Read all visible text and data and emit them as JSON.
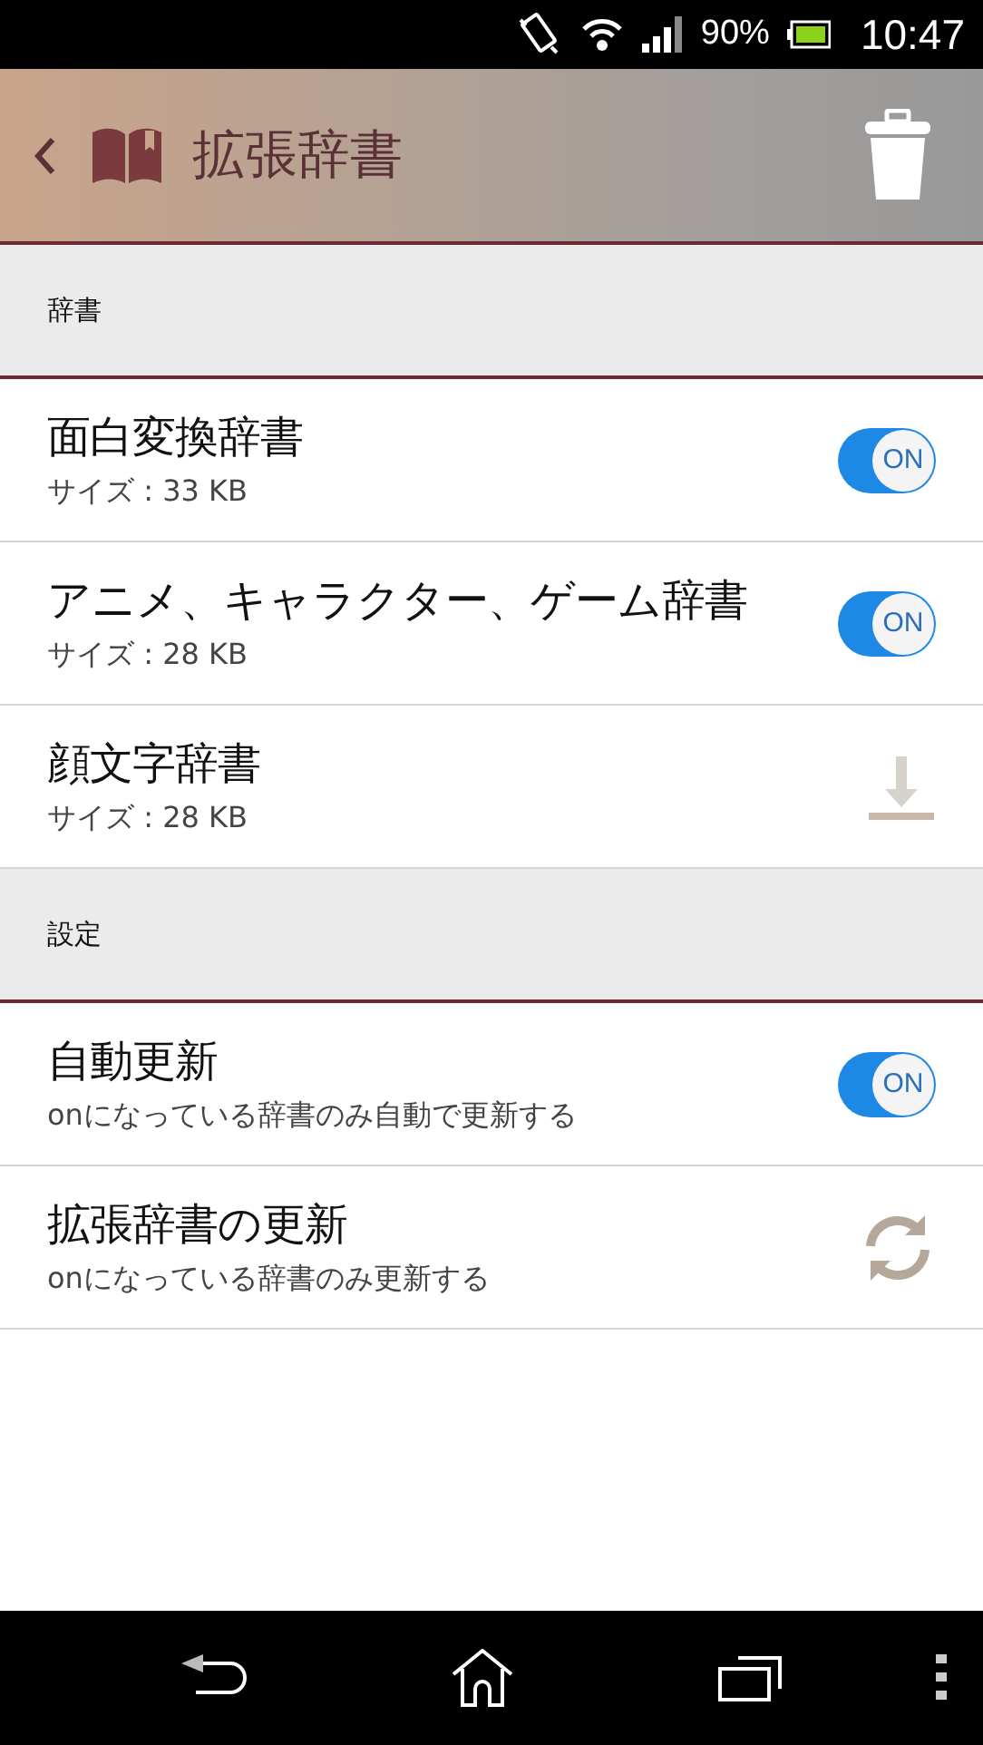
{
  "status_bar": {
    "battery": "90%",
    "time": "10:47"
  },
  "app_bar": {
    "title": "拡張辞書"
  },
  "sections": [
    {
      "header": "辞書",
      "items": [
        {
          "kind": "toggle",
          "title": "面白変換辞書",
          "subtitle": "サイズ : 33 KB",
          "on": true,
          "toggle_label": "ON"
        },
        {
          "kind": "toggle",
          "title": "アニメ、キャラクター、ゲーム辞書",
          "subtitle": "サイズ : 28 KB",
          "on": true,
          "toggle_label": "ON"
        },
        {
          "kind": "download",
          "title": "顔文字辞書",
          "subtitle": "サイズ : 28 KB"
        }
      ]
    },
    {
      "header": "設定",
      "items": [
        {
          "kind": "toggle",
          "title": "自動更新",
          "subtitle": "onになっている辞書のみ自動で更新する",
          "on": true,
          "toggle_label": "ON"
        },
        {
          "kind": "refresh",
          "title": "拡張辞書の更新",
          "subtitle": "onになっている辞書のみ更新する"
        }
      ]
    }
  ]
}
